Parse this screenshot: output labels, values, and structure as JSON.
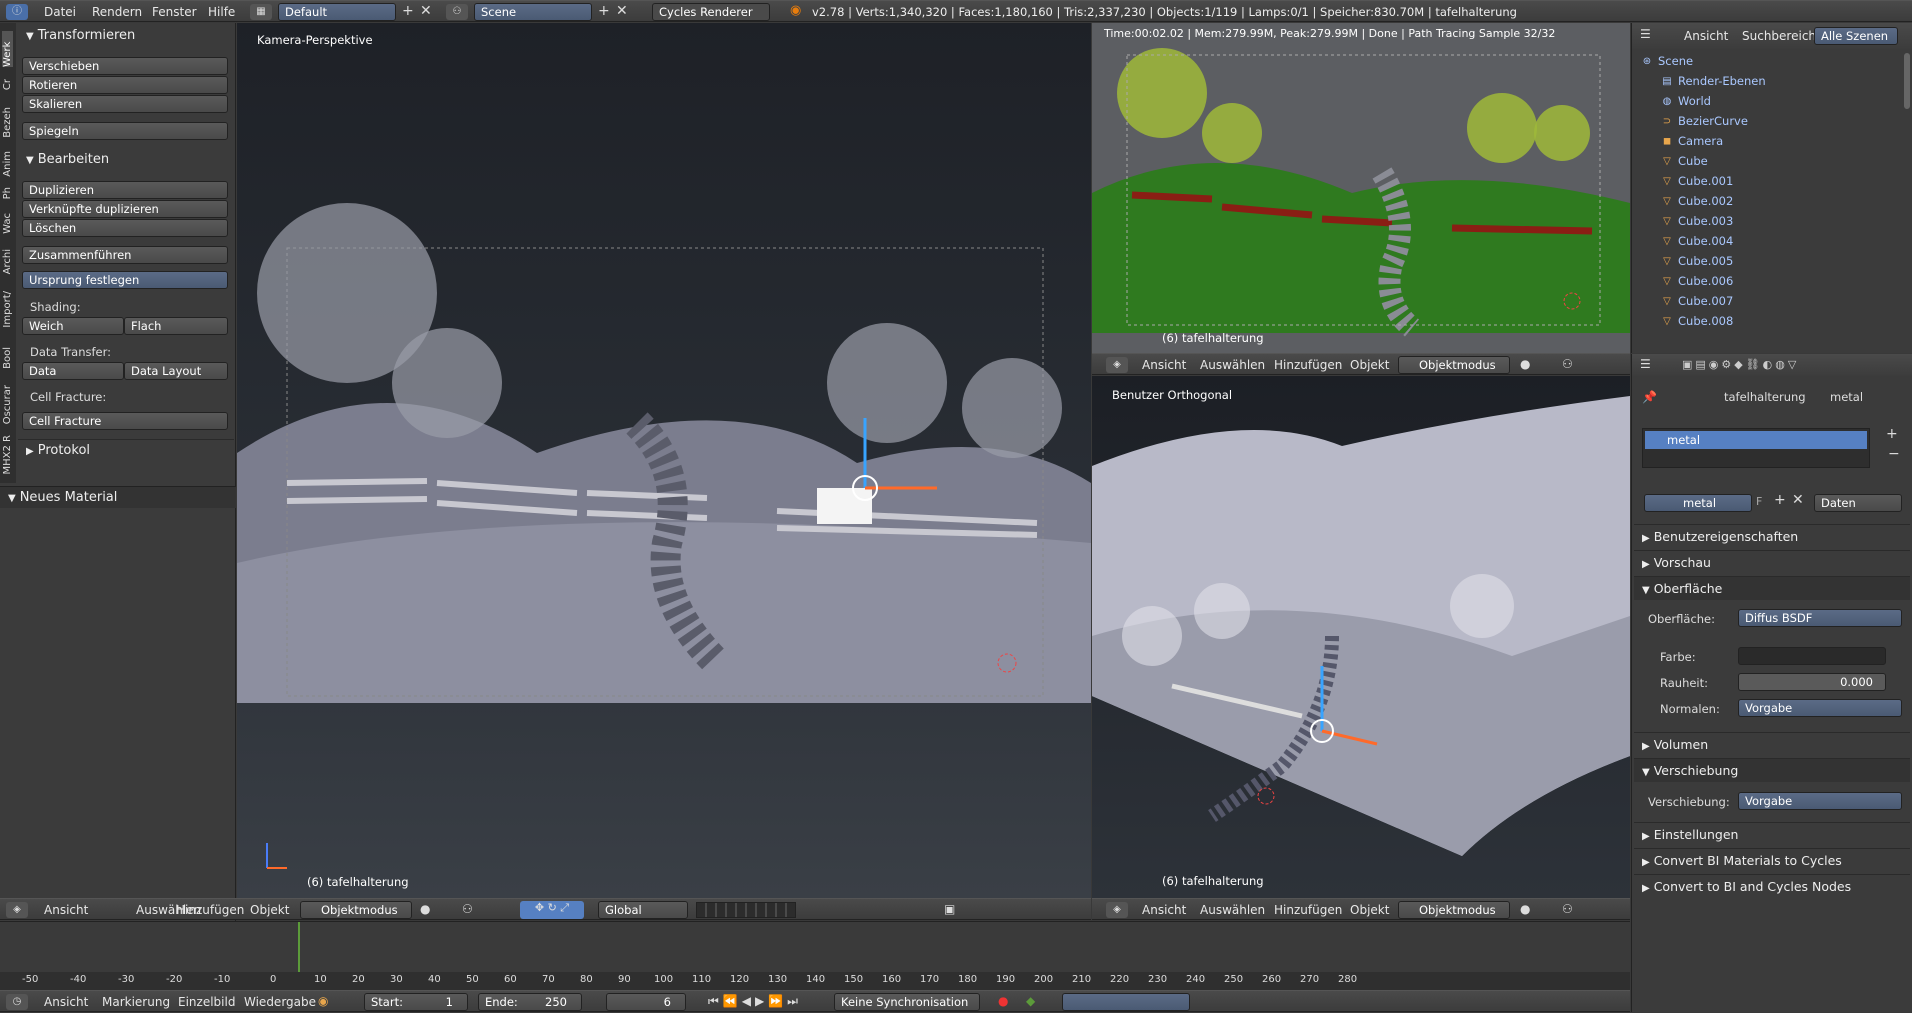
{
  "topbar": {
    "menus": [
      "Datei",
      "Rendern",
      "Fenster",
      "Hilfe"
    ],
    "layout": "Default",
    "scene": "Scene",
    "engine": "Cycles Renderer",
    "stats": "v2.78 | Verts:1,340,320 | Faces:1,180,160 | Tris:2,337,230 | Objects:1/119 | Lamps:0/1 | Speicher:830.70M | tafelhalterung"
  },
  "toolshelf": {
    "tabs": [
      "Werk",
      "Cr",
      "Bezeh",
      "Anim",
      "Ph",
      "Wac",
      "Archi",
      "Import/",
      "Bool",
      "Oscurar",
      "MHX2 R"
    ],
    "transform_title": "Transformieren",
    "transform": [
      "Verschieben",
      "Rotieren",
      "Skalieren",
      "Spiegeln"
    ],
    "edit_title": "Bearbeiten",
    "edit": [
      "Duplizieren",
      "Verknüpfte duplizieren",
      "Löschen",
      "Zusammenführen"
    ],
    "origin": "Ursprung festlegen",
    "shading_label": "Shading:",
    "shading": [
      "Weich",
      "Flach"
    ],
    "data_transfer_label": "Data Transfer:",
    "data_transfer": [
      "Data",
      "Data Layout"
    ],
    "cell_fracture_label": "Cell Fracture:",
    "cell_fracture": "Cell Fracture",
    "protokoll": "Protokol",
    "neues_material": "Neues Material"
  },
  "viewport_main": {
    "label": "Kamera-Perspektive",
    "object": "(6) tafelhalterung",
    "menus": [
      "Ansicht",
      "Auswählen",
      "Hinzufügen",
      "Objekt"
    ],
    "mode": "Objektmodus",
    "orientation": "Global"
  },
  "viewport_render": {
    "status": "Time:00:02.02 | Mem:279.99M, Peak:279.99M | Done | Path Tracing Sample 32/32",
    "object": "(6) tafelhalterung",
    "menus": [
      "Ansicht",
      "Auswählen",
      "Hinzufügen",
      "Objekt"
    ],
    "mode": "Objektmodus"
  },
  "viewport_ortho": {
    "label": "Benutzer Orthogonal",
    "object": "(6) tafelhalterung",
    "menus": [
      "Ansicht",
      "Auswählen",
      "Hinzufügen",
      "Objekt"
    ],
    "mode": "Objektmodus"
  },
  "outliner": {
    "tabs": [
      "Ansicht",
      "Suchbereich",
      "Alle Szenen"
    ],
    "items": [
      "Scene",
      "Render-Ebenen",
      "World",
      "BezierCurve",
      "Camera",
      "Cube",
      "Cube.001",
      "Cube.002",
      "Cube.003",
      "Cube.004",
      "Cube.005",
      "Cube.006",
      "Cube.007",
      "Cube.008"
    ]
  },
  "properties": {
    "breadcrumb_object": "tafelhalterung",
    "breadcrumb_material": "metal",
    "slot": "metal",
    "material_name": "metal",
    "fake_user": "F",
    "link": "Daten",
    "panels": {
      "custom": "Benutzereigenschaften",
      "preview": "Vorschau",
      "surface": "Oberfläche",
      "volume": "Volumen",
      "displacement": "Verschiebung",
      "settings": "Einstellungen",
      "convert1": "Convert BI Materials to Cycles",
      "convert2": "Convert to BI and Cycles Nodes"
    },
    "surface_label": "Oberfläche:",
    "surface_value": "Diffus BSDF",
    "color_label": "Farbe:",
    "roughness_label": "Rauheit:",
    "roughness_value": "0.000",
    "normal_label": "Normalen:",
    "normal_value": "Vorgabe",
    "disp_label": "Verschiebung:",
    "disp_value": "Vorgabe"
  },
  "timeline": {
    "ticks": [
      "-50",
      "-40",
      "-30",
      "-20",
      "-10",
      "0",
      "10",
      "20",
      "30",
      "40",
      "50",
      "60",
      "70",
      "80",
      "90",
      "100",
      "110",
      "120",
      "130",
      "140",
      "150",
      "160",
      "170",
      "180",
      "190",
      "200",
      "210",
      "220",
      "230",
      "240",
      "250",
      "260",
      "270",
      "280"
    ],
    "menus": [
      "Ansicht",
      "Markierung",
      "Einzelbild",
      "Wiedergabe"
    ],
    "start_label": "Start:",
    "start": "1",
    "end_label": "Ende:",
    "end": "250",
    "current": "6",
    "sync": "Keine Synchronisation"
  },
  "colors": {
    "accent": "#5680c2",
    "header": "#444444",
    "viewport": "#393939",
    "render_green": "#2f7a1f"
  }
}
